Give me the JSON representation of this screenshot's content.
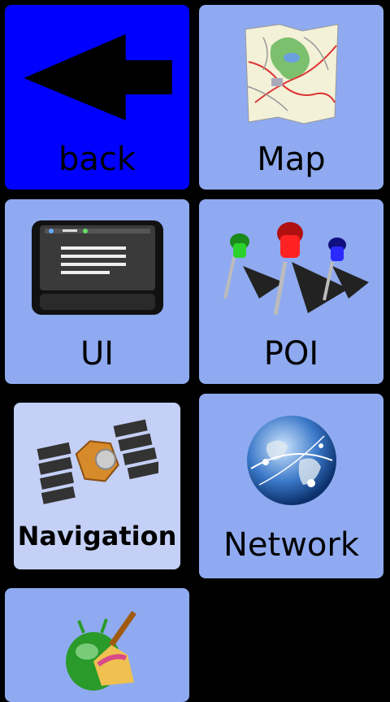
{
  "tiles": {
    "back": {
      "label": "back",
      "icon": "back-arrow-icon",
      "color": "#0000ff"
    },
    "map": {
      "label": "Map",
      "icon": "map-icon"
    },
    "ui": {
      "label": "UI",
      "icon": "screen-icon"
    },
    "poi": {
      "label": "POI",
      "icon": "pushpins-icon"
    },
    "navigation": {
      "label": "Navigation",
      "icon": "satellite-icon"
    },
    "network": {
      "label": "Network",
      "icon": "globe-icon"
    },
    "cleanup": {
      "label": "",
      "icon": "broom-bug-icon"
    }
  },
  "colors": {
    "tile": "#8faaf0",
    "selected_tile": "#c4d0f6",
    "background": "#000000"
  }
}
